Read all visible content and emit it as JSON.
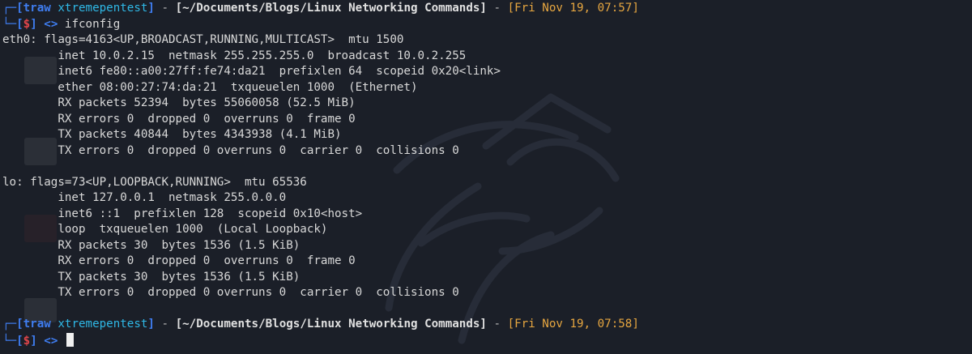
{
  "prompt1": {
    "corner_top": "┌─",
    "open_bracket": "[",
    "user": "traw",
    "host": "xtremepentest",
    "close_bracket": "]",
    "dash1": " - ",
    "path": "[~/Documents/Blogs/Linux Networking Commands]",
    "dash2": " - ",
    "time": "[Fri Nov 19, 07:57]",
    "corner_bottom": "└─",
    "symbol_open": "[",
    "symbol": "$",
    "symbol_close": "]",
    "arrow": " <> ",
    "command": "ifconfig"
  },
  "output_lines": [
    "eth0: flags=4163<UP,BROADCAST,RUNNING,MULTICAST>  mtu 1500",
    "        inet 10.0.2.15  netmask 255.255.255.0  broadcast 10.0.2.255",
    "        inet6 fe80::a00:27ff:fe74:da21  prefixlen 64  scopeid 0x20<link>",
    "        ether 08:00:27:74:da:21  txqueuelen 1000  (Ethernet)",
    "        RX packets 52394  bytes 55060058 (52.5 MiB)",
    "        RX errors 0  dropped 0  overruns 0  frame 0",
    "        TX packets 40844  bytes 4343938 (4.1 MiB)",
    "        TX errors 0  dropped 0 overruns 0  carrier 0  collisions 0",
    "",
    "lo: flags=73<UP,LOOPBACK,RUNNING>  mtu 65536",
    "        inet 127.0.0.1  netmask 255.0.0.0",
    "        inet6 ::1  prefixlen 128  scopeid 0x10<host>",
    "        loop  txqueuelen 1000  (Local Loopback)",
    "        RX packets 30  bytes 1536 (1.5 KiB)",
    "        RX errors 0  dropped 0  overruns 0  frame 0",
    "        TX packets 30  bytes 1536 (1.5 KiB)",
    "        TX errors 0  dropped 0 overruns 0  carrier 0  collisions 0",
    ""
  ],
  "prompt2": {
    "corner_top": "┌─",
    "open_bracket": "[",
    "user": "traw",
    "host": "xtremepentest",
    "close_bracket": "]",
    "dash1": " - ",
    "path": "[~/Documents/Blogs/Linux Networking Commands]",
    "dash2": " - ",
    "time": "[Fri Nov 19, 07:58]",
    "corner_bottom": "└─",
    "symbol_open": "[",
    "symbol": "$",
    "symbol_close": "]",
    "arrow": " <> ",
    "command": ""
  },
  "colors": {
    "background": "#1b1f28",
    "prompt_frame": "#3f7df0",
    "prompt_host": "#2fb8e6",
    "prompt_symbol": "#e0454a",
    "prompt_time": "#e6a640",
    "text": "#d8d8d8"
  },
  "icons": {
    "background_watermark": "kali-dragon-icon",
    "cursor": "block-cursor"
  }
}
